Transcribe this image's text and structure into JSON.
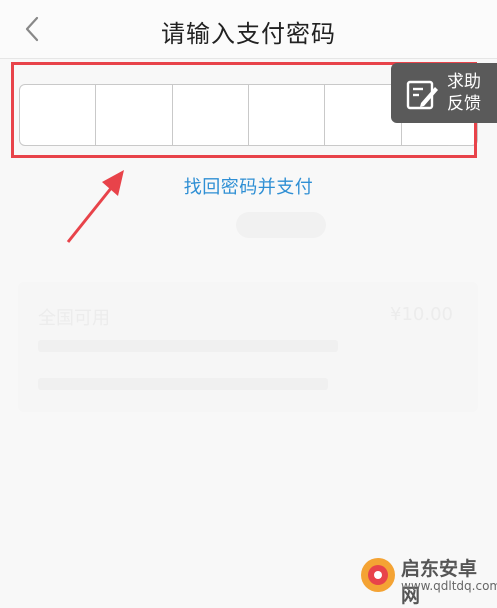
{
  "header": {
    "title": "请输入支付密码",
    "back_icon": "chevron-left-icon"
  },
  "password": {
    "digits": [
      "",
      "",
      "",
      "",
      "",
      ""
    ]
  },
  "feedback": {
    "label": "求助\n反馈",
    "icon": "edit-note-icon"
  },
  "recover_link": "找回密码并支付",
  "background": {
    "card_title": "全国可用",
    "price": "¥10.00"
  },
  "watermark": {
    "name": "启东安卓网",
    "url": "www.qdltdq.com"
  },
  "colors": {
    "highlight": "#e8434a",
    "link": "#2f8fd4",
    "feedback_bg": "#5a5a5a"
  }
}
